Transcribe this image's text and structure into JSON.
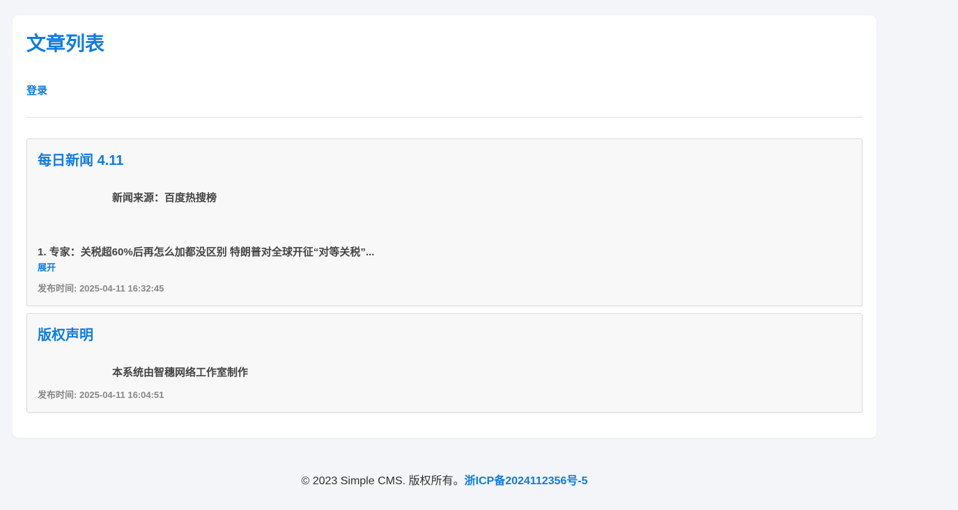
{
  "header": {
    "title": "文章列表",
    "login_label": "登录"
  },
  "articles": [
    {
      "title": "每日新闻 4.11",
      "source": "新闻来源：百度热搜榜",
      "excerpt": "1. 专家：关税超60%后再怎么加都没区别 特朗普对全球开征“对等关税”...",
      "expand_label": "展开",
      "date": "发布时间: 2025-04-11 16:32:45"
    },
    {
      "title": "版权声明",
      "source": "本系统由智穗网络工作室制作",
      "date": "发布时间: 2025-04-11 16:04:51"
    }
  ],
  "footer": {
    "copyright": "© 2023 Simple CMS. 版权所有。",
    "icp": "浙ICP备2024112356号-5"
  },
  "colors": {
    "accent": "#0f7ce0",
    "background": "#f4f5f8",
    "card_background": "#f8f8f9"
  }
}
